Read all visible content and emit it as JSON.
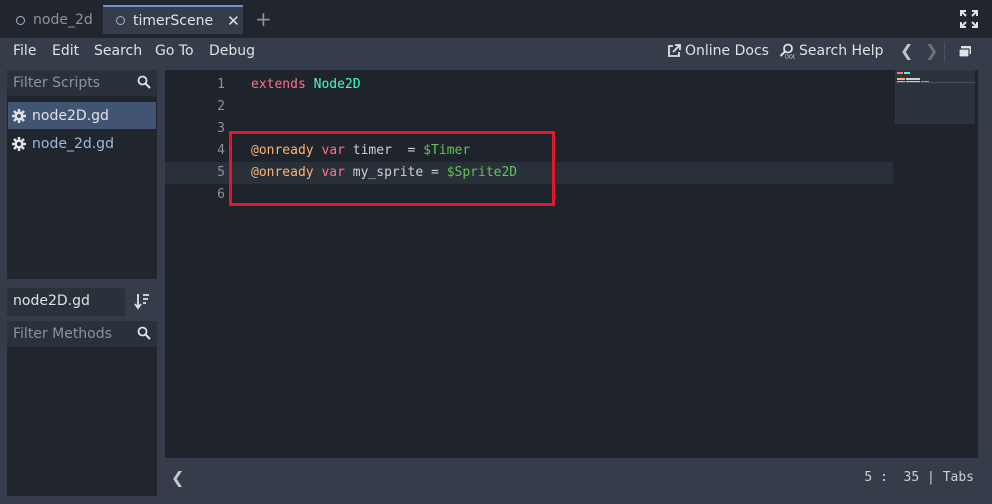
{
  "scene_tabs": [
    {
      "label": "node_2d"
    },
    {
      "label": "timerScene"
    }
  ],
  "menus": [
    "File",
    "Edit",
    "Search",
    "Go To",
    "Debug"
  ],
  "toolbar": {
    "online_docs": "Online Docs",
    "search_help": "Search Help"
  },
  "scripts_panel": {
    "filter_placeholder": "Filter Scripts",
    "items": [
      {
        "label": "node2D.gd"
      },
      {
        "label": "node_2d.gd"
      }
    ]
  },
  "methods_panel": {
    "current_file": "node2D.gd",
    "filter_placeholder": "Filter Methods"
  },
  "editor": {
    "lines": [
      {
        "num": "1",
        "tokens": [
          {
            "t": "extends",
            "c": "kw"
          },
          {
            "t": " ",
            "c": "txt"
          },
          {
            "t": "Node2D",
            "c": "type"
          }
        ]
      },
      {
        "num": "2",
        "tokens": []
      },
      {
        "num": "3",
        "tokens": []
      },
      {
        "num": "4",
        "tokens": [
          {
            "t": "@onready",
            "c": "ann"
          },
          {
            "t": " ",
            "c": "txt"
          },
          {
            "t": "var",
            "c": "kw"
          },
          {
            "t": " timer  = ",
            "c": "txt"
          },
          {
            "t": "$Timer",
            "c": "node"
          }
        ]
      },
      {
        "num": "5",
        "tokens": [
          {
            "t": "@onready",
            "c": "ann"
          },
          {
            "t": " ",
            "c": "txt"
          },
          {
            "t": "var",
            "c": "kw"
          },
          {
            "t": " my_sprite = ",
            "c": "txt"
          },
          {
            "t": "$Sprite2D",
            "c": "node"
          }
        ]
      },
      {
        "num": "6",
        "tokens": []
      }
    ],
    "current_line": 5
  },
  "status": {
    "position": "5 :  35 | Tabs"
  },
  "colors": {
    "keyword": "#ff7085",
    "annotation": "#ffb373",
    "type": "#42ffc2",
    "node_path": "#63c259",
    "highlight_box": "#e0182d",
    "accent": "#6f8ed1"
  },
  "icons": [
    "scene-icon",
    "close-icon",
    "add-icon",
    "fullscreen-icon",
    "external-link-icon",
    "search-help-icon",
    "chevron-left-icon",
    "chevron-right-icon",
    "panel-toggle-icon",
    "search-icon",
    "gear-icon",
    "sort-icon"
  ]
}
